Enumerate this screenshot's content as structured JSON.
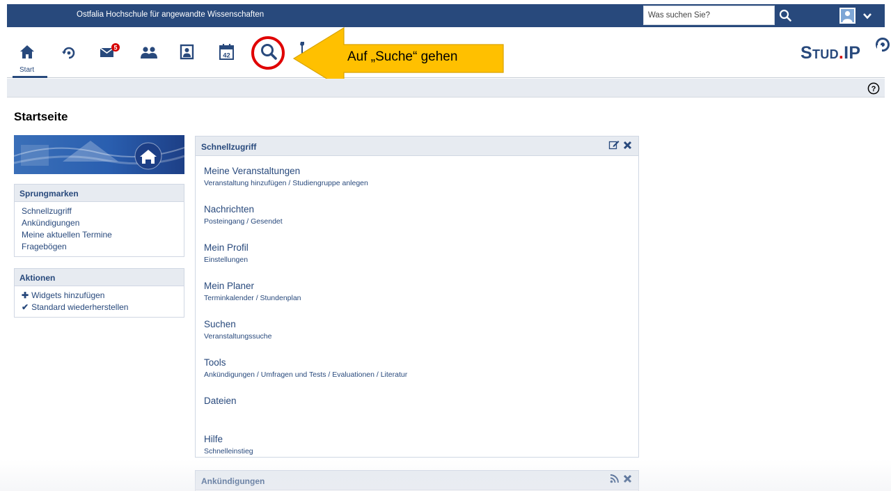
{
  "topbar": {
    "institution": "Ostfalia Hochschule für angewandte Wissenschaften",
    "search_placeholder": "Was suchen Sie?",
    "background": "#28497c"
  },
  "nav": {
    "items": [
      {
        "icon": "home-icon",
        "label": "Start",
        "active": true
      },
      {
        "icon": "activity-icon"
      },
      {
        "icon": "messages-icon",
        "badge": "5"
      },
      {
        "icon": "community-icon"
      },
      {
        "icon": "profile-icon"
      },
      {
        "icon": "calendar-icon",
        "text": "42"
      },
      {
        "icon": "search-icon"
      },
      {
        "icon": "tools-icon"
      }
    ],
    "logo": {
      "part1": "Stud",
      "dot": ".",
      "part2": "IP"
    }
  },
  "page": {
    "title": "Startseite"
  },
  "sidebar": {
    "jumpmarks": {
      "title": "Sprungmarken",
      "items": [
        "Schnellzugriff",
        "Ankündigungen",
        "Meine aktuellen Termine",
        "Fragebögen"
      ]
    },
    "actions": {
      "title": "Aktionen",
      "items": [
        {
          "glyph": "✚",
          "label": "Widgets hinzufügen"
        },
        {
          "glyph": "✔",
          "label": "Standard wiederherstellen"
        }
      ]
    }
  },
  "quickaccess": {
    "title": "Schnellzugriff",
    "entries": [
      {
        "title": "Meine Veranstaltungen",
        "sub": "Veranstaltung hinzufügen / Studiengruppe anlegen"
      },
      {
        "title": "Nachrichten",
        "sub": "Posteingang / Gesendet"
      },
      {
        "title": "Mein Profil",
        "sub": "Einstellungen"
      },
      {
        "title": "Mein Planer",
        "sub": "Terminkalender / Stundenplan"
      },
      {
        "title": "Suchen",
        "sub": "Veranstaltungssuche"
      },
      {
        "title": "Tools",
        "sub": "Ankündigungen / Umfragen und Tests / Evaluationen / Literatur"
      },
      {
        "title": "Dateien",
        "sub": ""
      },
      {
        "title": "Hilfe",
        "sub": "Schnelleinstieg"
      }
    ]
  },
  "announcements": {
    "title": "Ankündigungen"
  },
  "callout": {
    "text": "Auf „Suche“ gehen",
    "arrow_color": "#ffc000",
    "circle_color": "#e00000"
  }
}
